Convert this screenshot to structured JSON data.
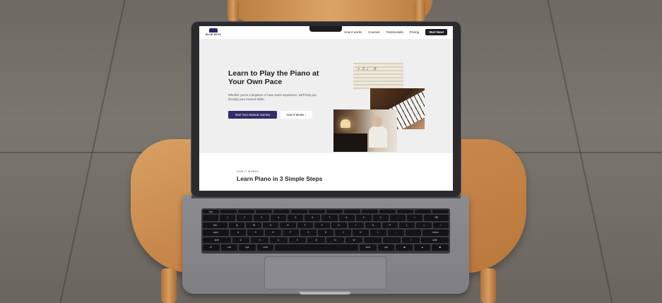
{
  "nav": {
    "logo_text": "BLUE KEYS",
    "links": [
      "How it works",
      "Courses",
      "Testimonials",
      "Pricing"
    ],
    "cta": "Start Now!"
  },
  "hero": {
    "title": "Learn to Play the Piano at Your Own Pace",
    "subtitle": "Whether you're a beginner or have some experience, we'll help you develop your musical skills!",
    "primary_button": "Start Your Musical Journey",
    "secondary_button": "How It Works ↓"
  },
  "section": {
    "eyebrow": "HOW IT WORKS",
    "title": "Learn Piano in 3 Simple Steps"
  },
  "colors": {
    "primary": "#2f2c66",
    "nav_cta": "#1d1d22",
    "hero_bg": "#efefef"
  },
  "keyboard": {
    "rows": [
      [
        "esc",
        "",
        "",
        "",
        "",
        "",
        "",
        "",
        "",
        "",
        "",
        "",
        "",
        ""
      ],
      [
        "`",
        "1",
        "2",
        "3",
        "4",
        "5",
        "6",
        "7",
        "8",
        "9",
        "0",
        "-",
        "=",
        "⌫"
      ],
      [
        "tab",
        "Q",
        "W",
        "E",
        "R",
        "T",
        "Y",
        "U",
        "I",
        "O",
        "P",
        "[",
        "]",
        "\\"
      ],
      [
        "caps",
        "A",
        "S",
        "D",
        "F",
        "G",
        "H",
        "J",
        "K",
        "L",
        ";",
        "'",
        "return"
      ],
      [
        "shift",
        "Z",
        "X",
        "C",
        "V",
        "B",
        "N",
        "M",
        ",",
        ".",
        "/",
        "shift"
      ],
      [
        "fn",
        "ctrl",
        "opt",
        "cmd",
        "",
        "cmd",
        "opt",
        "◀",
        "▲",
        "▶"
      ]
    ]
  }
}
